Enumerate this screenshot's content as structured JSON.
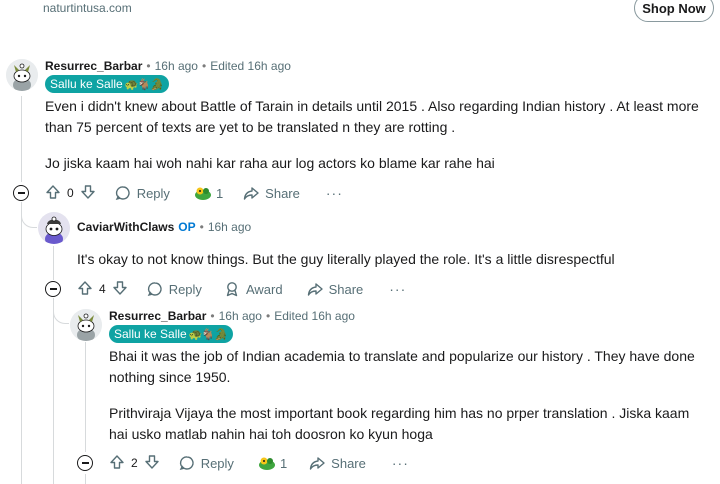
{
  "ad": {
    "domain": "naturtintusa.com",
    "cta": "Shop Now"
  },
  "comments": [
    {
      "author": "Resurrec_Barbar",
      "time": "16h ago",
      "edited": "Edited 16h ago",
      "flair": "Sallu ke Salle",
      "flair_emojis": "🐢🐐🐊",
      "paragraphs": [
        [
          "Even i didn't knew about Battle of Tarain in details until 2015 . Also regarding Indian history . At least more",
          "than 75 percent of texts are yet to be translated n they are rotting ."
        ],
        [
          "Jo jiska kaam hai woh nahi kar raha aur log actors ko blame kar rahe hai"
        ]
      ],
      "votes": "0",
      "reply_label": "Reply",
      "award_count": "1",
      "share_label": "Share",
      "more_label": "···"
    },
    {
      "author": "CaviarWithClaws",
      "op": "OP",
      "time": "16h ago",
      "paragraphs": [
        [
          "It's okay to not know things. But the guy literally played the role. It's a little disrespectful"
        ]
      ],
      "votes": "4",
      "reply_label": "Reply",
      "award_label": "Award",
      "share_label": "Share",
      "more_label": "···"
    },
    {
      "author": "Resurrec_Barbar",
      "time": "16h ago",
      "edited": "Edited 16h ago",
      "flair": "Sallu ke Salle",
      "flair_emojis": "🐢🐐🐊",
      "paragraphs": [
        [
          "Bhai it was the job of Indian academia to translate and popularize our history . They have done",
          "nothing since 1950."
        ],
        [
          "Prithviraja Vijaya the most important book regarding him has no prper translation . Jiska kaam",
          "hai usko matlab nahin hai toh doosron ko kyun hoga"
        ]
      ],
      "votes": "2",
      "reply_label": "Reply",
      "award_count": "1",
      "share_label": "Share",
      "more_label": "···"
    }
  ],
  "colors": {
    "flair_bg": "#0fa3a3",
    "op": "#0079d3",
    "thread_line": "#d7dadc",
    "meta_text": "#576f76"
  }
}
